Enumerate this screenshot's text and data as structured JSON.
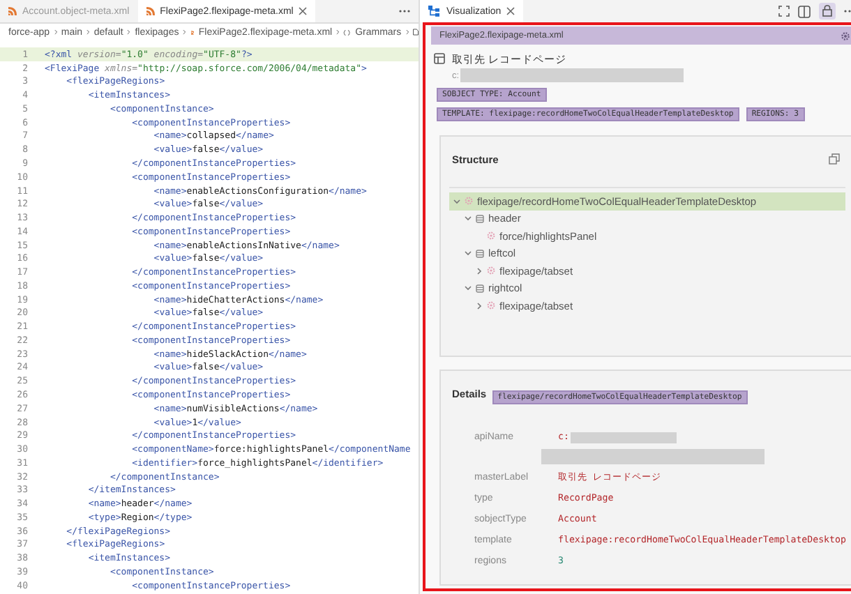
{
  "editor": {
    "tabs": [
      {
        "label": "Account.object-meta.xml",
        "selected": false
      },
      {
        "label": "FlexiPage2.flexipage-meta.xml",
        "selected": true
      }
    ],
    "breadcrumb": [
      {
        "label": "force-app",
        "kind": "folder"
      },
      {
        "label": "main",
        "kind": "folder"
      },
      {
        "label": "default",
        "kind": "folder"
      },
      {
        "label": "flexipages",
        "kind": "folder"
      },
      {
        "label": "FlexiPage2.flexipage-meta.xml",
        "kind": "file"
      },
      {
        "label": "Grammars",
        "kind": "symbol"
      }
    ],
    "lines": [
      {
        "number": "1",
        "code": "<?xml version=\"1.0\" encoding=\"UTF-8\"?>",
        "highlighted": true
      },
      {
        "number": "2",
        "code": "<FlexiPage xmlns=\"http://soap.sforce.com/2006/04/metadata\">",
        "highlighted": false
      },
      {
        "number": "3",
        "code": "    <flexiPageRegions>",
        "highlighted": false
      },
      {
        "number": "4",
        "code": "        <itemInstances>",
        "highlighted": false
      },
      {
        "number": "5",
        "code": "            <componentInstance>",
        "highlighted": false
      },
      {
        "number": "6",
        "code": "                <componentInstanceProperties>",
        "highlighted": false
      },
      {
        "number": "7",
        "code": "                    <name>collapsed</name>",
        "highlighted": false
      },
      {
        "number": "8",
        "code": "                    <value>false</value>",
        "highlighted": false
      },
      {
        "number": "9",
        "code": "                </componentInstanceProperties>",
        "highlighted": false
      },
      {
        "number": "10",
        "code": "                <componentInstanceProperties>",
        "highlighted": false
      },
      {
        "number": "11",
        "code": "                    <name>enableActionsConfiguration</name>",
        "highlighted": false
      },
      {
        "number": "12",
        "code": "                    <value>false</value>",
        "highlighted": false
      },
      {
        "number": "13",
        "code": "                </componentInstanceProperties>",
        "highlighted": false
      },
      {
        "number": "14",
        "code": "                <componentInstanceProperties>",
        "highlighted": false
      },
      {
        "number": "15",
        "code": "                    <name>enableActionsInNative</name>",
        "highlighted": false
      },
      {
        "number": "16",
        "code": "                    <value>false</value>",
        "highlighted": false
      },
      {
        "number": "17",
        "code": "                </componentInstanceProperties>",
        "highlighted": false
      },
      {
        "number": "18",
        "code": "                <componentInstanceProperties>",
        "highlighted": false
      },
      {
        "number": "19",
        "code": "                    <name>hideChatterActions</name>",
        "highlighted": false
      },
      {
        "number": "20",
        "code": "                    <value>false</value>",
        "highlighted": false
      },
      {
        "number": "21",
        "code": "                </componentInstanceProperties>",
        "highlighted": false
      },
      {
        "number": "22",
        "code": "                <componentInstanceProperties>",
        "highlighted": false
      },
      {
        "number": "23",
        "code": "                    <name>hideSlackAction</name>",
        "highlighted": false
      },
      {
        "number": "24",
        "code": "                    <value>false</value>",
        "highlighted": false
      },
      {
        "number": "25",
        "code": "                </componentInstanceProperties>",
        "highlighted": false
      },
      {
        "number": "26",
        "code": "                <componentInstanceProperties>",
        "highlighted": false
      },
      {
        "number": "27",
        "code": "                    <name>numVisibleActions</name>",
        "highlighted": false
      },
      {
        "number": "28",
        "code": "                    <value>1</value>",
        "highlighted": false
      },
      {
        "number": "29",
        "code": "                </componentInstanceProperties>",
        "highlighted": false
      },
      {
        "number": "30",
        "code": "                <componentName>force:highlightsPanel</componentName",
        "highlighted": false
      },
      {
        "number": "31",
        "code": "                <identifier>force_highlightsPanel</identifier>",
        "highlighted": false
      },
      {
        "number": "32",
        "code": "            </componentInstance>",
        "highlighted": false
      },
      {
        "number": "33",
        "code": "        </itemInstances>",
        "highlighted": false
      },
      {
        "number": "34",
        "code": "        <name>header</name>",
        "highlighted": false
      },
      {
        "number": "35",
        "code": "        <type>Region</type>",
        "highlighted": false
      },
      {
        "number": "36",
        "code": "    </flexiPageRegions>",
        "highlighted": false
      },
      {
        "number": "37",
        "code": "    <flexiPageRegions>",
        "highlighted": false
      },
      {
        "number": "38",
        "code": "        <itemInstances>",
        "highlighted": false
      },
      {
        "number": "39",
        "code": "            <componentInstance>",
        "highlighted": false
      },
      {
        "number": "40",
        "code": "                <componentInstanceProperties>",
        "highlighted": false
      }
    ]
  },
  "visualization": {
    "tab": {
      "label": "Visualization",
      "selected": true
    },
    "header": "FlexiPage2.flexipage-meta.xml",
    "page_label": "取引先 レコードページ",
    "api_prefix": "c:",
    "badges": [
      "SOBJECT TYPE: Account",
      "TEMPLATE: flexipage:recordHomeTwoColEqualHeaderTemplateDesktop",
      "REGIONS: 3"
    ],
    "structure": {
      "title": "Structure",
      "tree": [
        {
          "label": "flexipage/recordHomeTwoColEqualHeaderTemplateDesktop",
          "kind": "component",
          "expanded": true,
          "selected": true,
          "children": [
            {
              "label": "header",
              "kind": "region",
              "expanded": true,
              "selected": false,
              "children": [
                {
                  "label": "force/highlightsPanel",
                  "kind": "component",
                  "selected": false
                }
              ]
            },
            {
              "label": "leftcol",
              "kind": "region",
              "expanded": true,
              "selected": false,
              "children": [
                {
                  "label": "flexipage/tabset",
                  "kind": "component",
                  "expanded": false,
                  "selected": false
                }
              ]
            },
            {
              "label": "rightcol",
              "kind": "region",
              "expanded": true,
              "selected": false,
              "children": [
                {
                  "label": "flexipage/tabset",
                  "kind": "component",
                  "expanded": false,
                  "selected": false
                }
              ]
            }
          ]
        }
      ]
    },
    "details": {
      "title": "Details",
      "badge": "flexipage/recordHomeTwoColEqualHeaderTemplateDesktop",
      "rows": [
        {
          "key": "apiName",
          "value": "c:",
          "kind": "redacted"
        },
        {
          "key": "masterLabel",
          "value": "取引先 レコードページ",
          "kind": "string"
        },
        {
          "key": "type",
          "value": "RecordPage",
          "kind": "string"
        },
        {
          "key": "sobjectType",
          "value": "Account",
          "kind": "string"
        },
        {
          "key": "template",
          "value": "flexipage:recordHomeTwoColEqualHeaderTemplateDesktop",
          "kind": "string"
        },
        {
          "key": "regions",
          "value": "3",
          "kind": "number"
        }
      ]
    }
  }
}
